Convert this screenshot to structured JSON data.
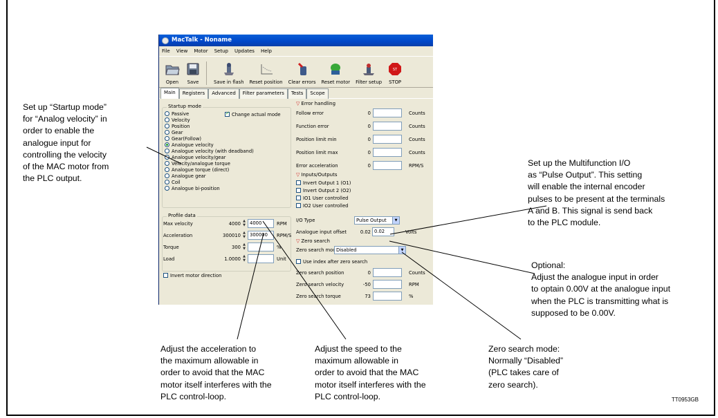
{
  "window": {
    "title": "MacTalk - Noname",
    "menu": [
      "File",
      "View",
      "Motor",
      "Setup",
      "Updates",
      "Help"
    ],
    "toolbar": [
      {
        "label": "Open",
        "icon": "open-folder-icon"
      },
      {
        "label": "Save",
        "icon": "save-disk-icon"
      },
      {
        "label": "Save in flash",
        "icon": "flash-save-icon"
      },
      {
        "label": "Reset position",
        "icon": "reset-position-icon"
      },
      {
        "label": "Clear errors",
        "icon": "clear-errors-icon"
      },
      {
        "label": "Reset motor",
        "icon": "reset-motor-icon"
      },
      {
        "label": "Filter setup",
        "icon": "filter-setup-icon"
      },
      {
        "label": "STOP",
        "icon": "stop-sign-icon"
      }
    ],
    "tabs": [
      "Main",
      "Registers",
      "Advanced",
      "Filter parameters",
      "Tests",
      "Scope"
    ],
    "active_tab": "Main"
  },
  "startup": {
    "title": "Startup mode",
    "change_actual_mode": "Change actual mode",
    "modes": [
      "Passive",
      "Velocity",
      "Position",
      "Gear",
      "Gear(Follow)",
      "Analogue velocity",
      "Analogue velocity (with deadband)",
      "Analogue velocity/gear",
      "Velocity/analogue torque",
      "Analogue torque (direct)",
      "Analogue gear",
      "Coil",
      "Analogue bi-position"
    ],
    "selected": "Analogue velocity"
  },
  "profile": {
    "title": "Profile data",
    "rows": [
      {
        "label": "Max velocity",
        "value": "4000",
        "input": "4000",
        "unit": "RPM"
      },
      {
        "label": "Acceleration",
        "value": "300010",
        "input": "300000",
        "unit": "RPM/S"
      },
      {
        "label": "Torque",
        "value": "300",
        "input": "",
        "unit": "%"
      },
      {
        "label": "Load",
        "value": "1.0000",
        "input": "",
        "unit": "Unit"
      }
    ],
    "invert": "Invert motor direction"
  },
  "errors": {
    "title": "Error handling",
    "rows": [
      {
        "label": "Follow error",
        "value": "0",
        "unit": "Counts"
      },
      {
        "label": "Function error",
        "value": "0",
        "unit": "Counts"
      },
      {
        "label": "Position limit min",
        "value": "0",
        "unit": "Counts"
      },
      {
        "label": "Position limit max",
        "value": "0",
        "unit": "Counts"
      },
      {
        "label": "Error acceleration",
        "value": "0",
        "unit": "RPM/S"
      }
    ]
  },
  "io": {
    "title": "Inputs/Outputs",
    "checks": [
      "Invert Output 1 (O1)",
      "Invert Output 2 (O2)",
      "IO1 User controlled",
      "IO2 User controlled"
    ],
    "io_type_label": "I/O Type",
    "io_type_value": "Pulse Output",
    "offset_label": "Analogue input offset",
    "offset_value": "0.02",
    "offset_input": "0.02",
    "offset_unit": "Volts"
  },
  "zero": {
    "title": "Zero search",
    "mode_label": "Zero search mode",
    "mode_value": "Disabled",
    "use_index": "Use index after zero search",
    "rows": [
      {
        "label": "Zero search position",
        "value": "0",
        "unit": "Counts"
      },
      {
        "label": "Zero search velocity",
        "value": "-50",
        "unit": "RPM"
      },
      {
        "label": "Zero search torque",
        "value": "73",
        "unit": "%"
      }
    ]
  },
  "annotations": {
    "startup": [
      "Set up “Startup mode”",
      "for “Analog velocity” in",
      "order to enable the",
      "analogue input for",
      "controlling the velocity",
      "of the MAC motor from",
      "the PLC output."
    ],
    "multifunction": [
      "Set up the Multifunction I/O",
      "as “Pulse Output”. This setting",
      "will enable the internal encoder",
      "pulses to be present at the terminals",
      "A and B. This signal is send back",
      "to the PLC module."
    ],
    "optional": [
      "Optional:",
      "Adjust the analogue input in order",
      "to optain 0.00V at the analogue input",
      "when the PLC is transmitting what is",
      "supposed to be 0.00V."
    ],
    "acceleration": [
      "Adjust the acceleration to",
      "the maximum allowable in",
      "order to avoid that the MAC",
      "motor itself interferes with the",
      "PLC control-loop."
    ],
    "speed": [
      "Adjust the speed to the",
      "maximum allowable in",
      "order to avoid that the MAC",
      "motor itself interferes with the",
      "PLC control-loop."
    ],
    "zero": [
      "Zero search mode:",
      "Normally “Disabled”",
      "(PLC takes care of",
      "zero search)."
    ]
  },
  "figure_ref": "TT0953GB"
}
